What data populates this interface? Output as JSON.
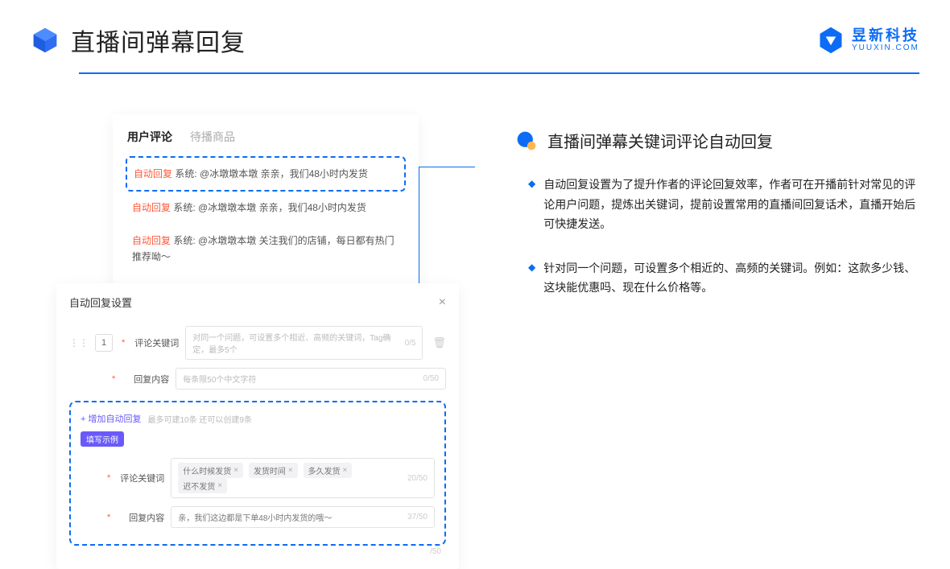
{
  "header": {
    "title": "直播间弹幕回复",
    "brand_cn": "昱新科技",
    "brand_en": "YUUXIN.COM"
  },
  "comments": {
    "tab_active": "用户评论",
    "tab_inactive": "待播商品",
    "items": [
      {
        "tag": "自动回复",
        "prefix": "系统:",
        "text": "@冰墩墩本墩 亲亲，我们48小时内发货"
      },
      {
        "tag": "自动回复",
        "prefix": "系统:",
        "text": "@冰墩墩本墩 亲亲，我们48小时内发货"
      },
      {
        "tag": "自动回复",
        "prefix": "系统:",
        "text": "@冰墩墩本墩 关注我们的店铺，每日都有热门推荐呦～"
      }
    ]
  },
  "settings": {
    "title": "自动回复设置",
    "close": "×",
    "index": "1",
    "keyword_label": "评论关键词",
    "keyword_placeholder": "对同一个问题，可设置多个相近、高频的关键词，Tag确定，最多5个",
    "keyword_count": "0/5",
    "content_label": "回复内容",
    "content_placeholder": "每条限50个中文字符",
    "content_count": "0/50",
    "add_text": "+ 增加自动回复",
    "add_hint": "最多可建10条 还可以创建9条",
    "example_badge": "填写示例",
    "example_keyword_label": "评论关键词",
    "example_tags": [
      "什么时候发货",
      "发货时间",
      "多久发货",
      "迟不发货"
    ],
    "example_kw_count": "20/50",
    "example_content_label": "回复内容",
    "example_content_value": "亲，我们这边都是下单48小时内发货的哦～",
    "example_content_count": "37/50",
    "outer_count": "/50"
  },
  "right": {
    "section_title": "直播间弹幕关键词评论自动回复",
    "bullets": [
      "自动回复设置为了提升作者的评论回复效率，作者可在开播前针对常见的评论用户问题，提炼出关键词，提前设置常用的直播间回复话术，直播开始后可快捷发送。",
      "针对同一个问题，可设置多个相近的、高频的关键词。例如：这款多少钱、这块能优惠吗、现在什么价格等。"
    ]
  }
}
